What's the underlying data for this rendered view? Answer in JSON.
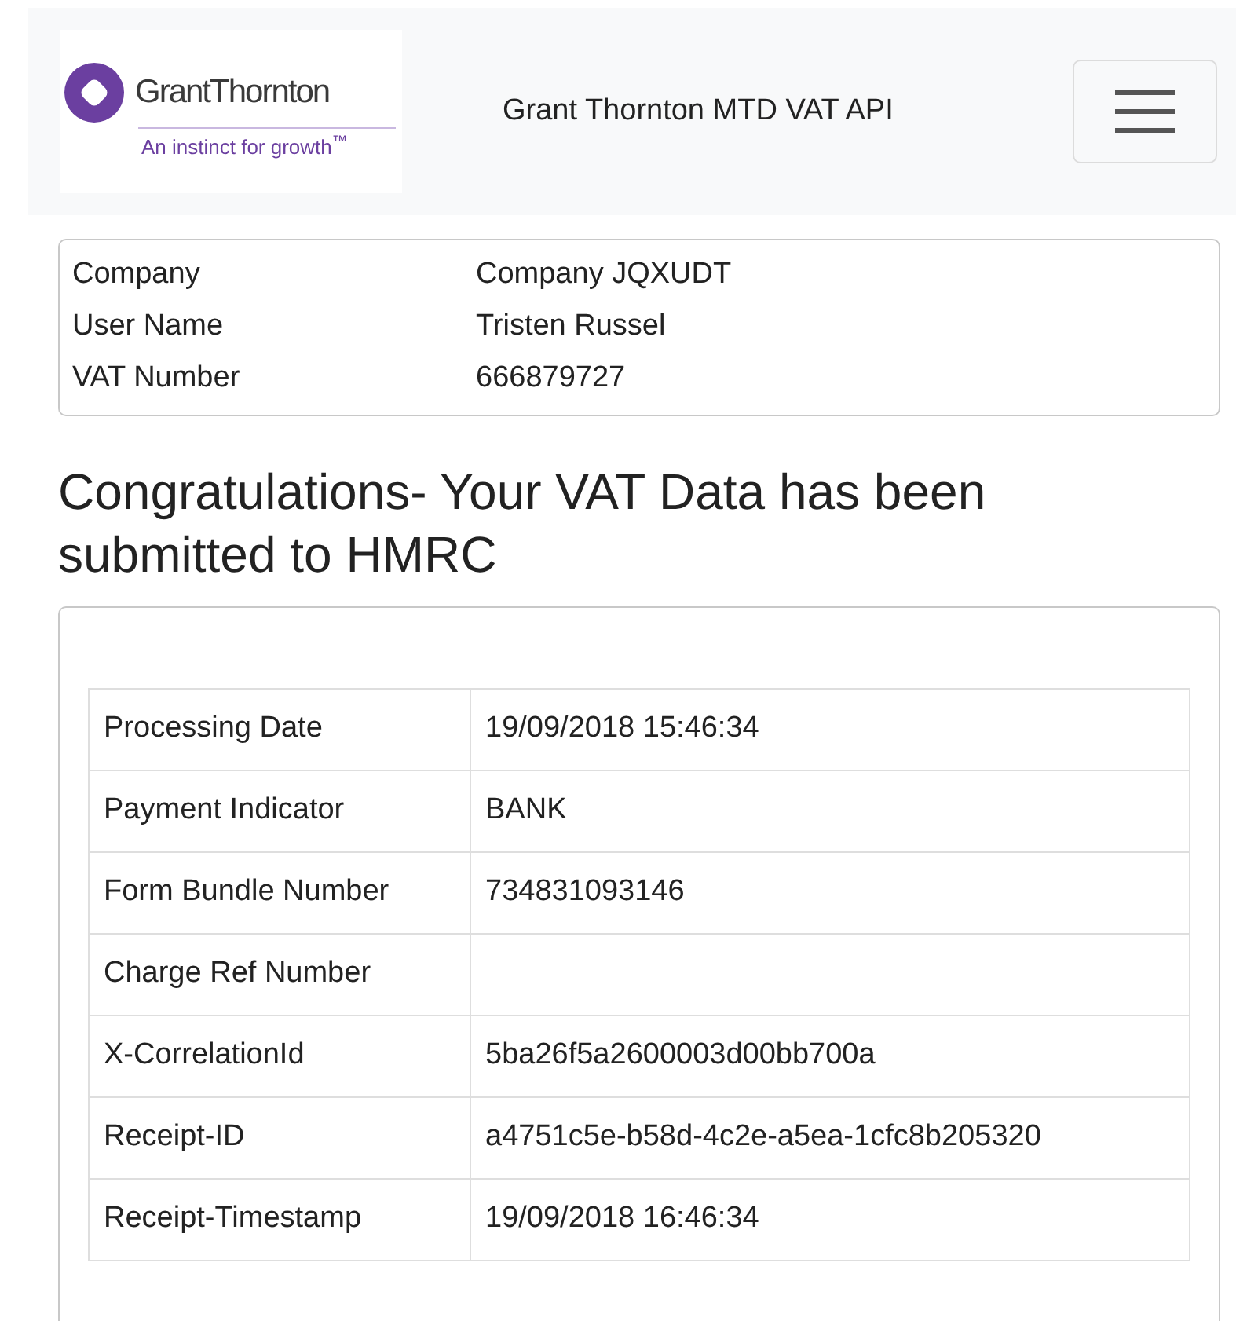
{
  "navbar": {
    "logo": {
      "name": "GrantThornton",
      "tagline": "An instinct for growth$^{™}$"
    },
    "title": "Grant Thornton MTD VAT API"
  },
  "account": [
    {
      "label": "Company",
      "value": "Company JQXUDT"
    },
    {
      "label": "User Name",
      "value": "Tristen Russel"
    },
    {
      "label": "VAT Number",
      "value": "666879727"
    }
  ],
  "heading": "Congratulations- Your VAT Data has been submitted to HMRC",
  "receipt": [
    {
      "label": "Processing Date",
      "value": "19/09/2018 15:46:34"
    },
    {
      "label": "Payment Indicator",
      "value": "BANK"
    },
    {
      "label": "Form Bundle Number",
      "value": "734831093146"
    },
    {
      "label": "Charge Ref Number"
    },
    {
      "label": "X-CorrelationId",
      "value": "5ba26f5a2600003d00bb700a"
    },
    {
      "label": "Receipt-ID",
      "value": "a4751c5e-b58d-4c2e-a5ea-1cfc8b205320"
    },
    {
      "label": "Receipt-Timestamp",
      "value": "19/09/2018 16:46:34"
    }
  ]
}
